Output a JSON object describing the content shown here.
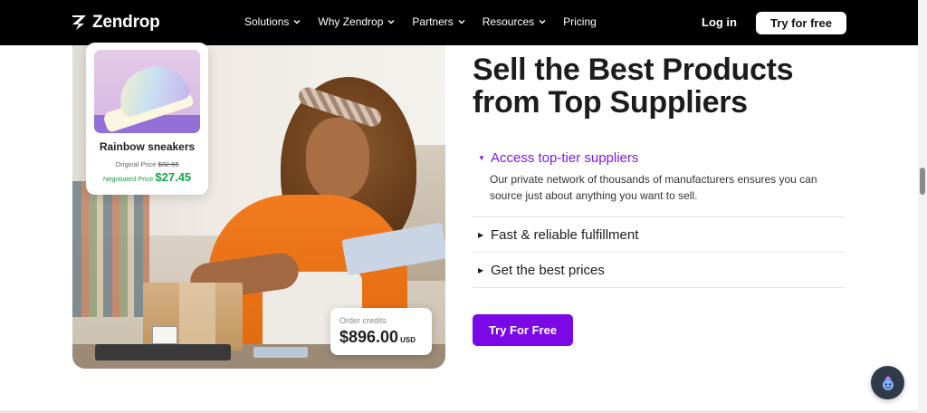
{
  "nav": {
    "brand": "Zendrop",
    "menu": [
      {
        "label": "Solutions",
        "has_dropdown": true
      },
      {
        "label": "Why Zendrop",
        "has_dropdown": true
      },
      {
        "label": "Partners",
        "has_dropdown": true
      },
      {
        "label": "Resources",
        "has_dropdown": true
      },
      {
        "label": "Pricing",
        "has_dropdown": false
      }
    ],
    "login": "Log in",
    "try_free": "Try for free"
  },
  "hero_image": {
    "product_card": {
      "title": "Rainbow sneakers",
      "original_label": "Original Price",
      "original_price": "$32.65",
      "negotiated_label": "Negotiated Price",
      "negotiated_price": "$27.45"
    },
    "credits_card": {
      "label": "Order credits",
      "amount": "$896.00",
      "currency": "USD"
    }
  },
  "main": {
    "headline": "Sell the Best Products from Top Suppliers",
    "features": [
      {
        "title": "Access top-tier suppliers",
        "expanded": true,
        "body": "Our private network of thousands of manufacturers ensures you can source just about anything you want to sell."
      },
      {
        "title": "Fast & reliable fulfillment",
        "expanded": false
      },
      {
        "title": "Get the best prices",
        "expanded": false
      }
    ],
    "cta": "Try For Free"
  },
  "colors": {
    "accent": "#7a09e6",
    "accent_text": "#7a17f1",
    "nav_bg": "#000000",
    "price_green": "#18a24a"
  },
  "icons": {
    "logo": "zendrop-z-logo",
    "dropdown": "chevron-down-icon",
    "bullet": "triangle-bullet-icon",
    "chat": "chat-bot-icon"
  }
}
